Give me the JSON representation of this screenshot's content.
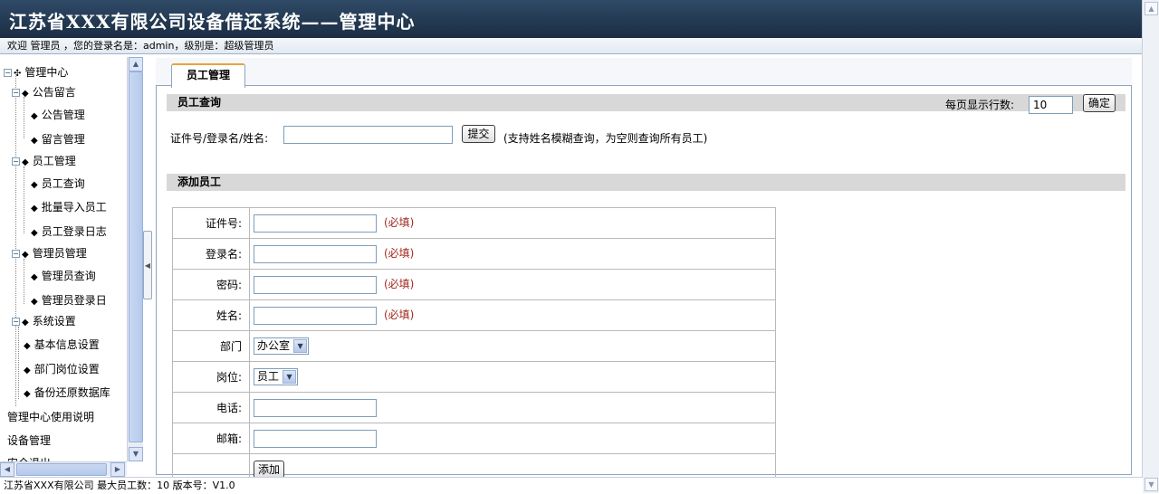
{
  "header": {
    "title": "江苏省XXX有限公司设备借还系统——管理中心",
    "welcome": "欢迎 管理员 ，您的登录名是：admin，级别是：超级管理员"
  },
  "sidebar": {
    "root": "管理中心",
    "groups": [
      {
        "label": "公告留言",
        "items": [
          "公告管理",
          "留言管理"
        ]
      },
      {
        "label": "员工管理",
        "items": [
          "员工查询",
          "批量导入员工",
          "员工登录日志"
        ]
      },
      {
        "label": "管理员管理",
        "items": [
          "管理员查询",
          "管理员登录日"
        ]
      },
      {
        "label": "系统设置",
        "items": [
          "基本信息设置",
          "部门岗位设置",
          "备份还原数据库"
        ]
      }
    ],
    "links": [
      "管理中心使用说明",
      "设备管理",
      "安全退出"
    ]
  },
  "tab": {
    "label": "员工管理"
  },
  "query": {
    "section_title": "员工查询",
    "rows_label": "每页显示行数:",
    "rows_value": "10",
    "confirm_label": "确定",
    "search_label": "证件号/登录名/姓名:",
    "search_value": "",
    "submit_label": "提交",
    "hint": "(支持姓名模糊查询，为空则查询所有员工)"
  },
  "add": {
    "section_title": "添加员工",
    "required_text": "(必填)",
    "fields": {
      "id_label": "证件号:",
      "login_label": "登录名:",
      "password_label": "密码:",
      "name_label": "姓名:",
      "dept_label": "部门",
      "dept_value": "办公室",
      "position_label": "岗位:",
      "position_value": "员工",
      "phone_label": "电话:",
      "email_label": "邮箱:"
    },
    "submit_label": "添加"
  },
  "footer": {
    "text": "江苏省XXX有限公司 最大员工数：10 版本号：V1.0"
  }
}
